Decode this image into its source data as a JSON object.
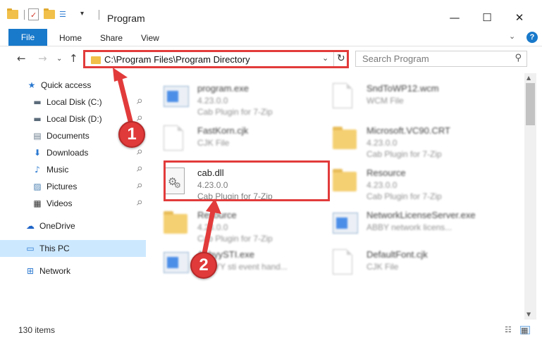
{
  "window": {
    "title": "Program",
    "controls": {
      "minimize": "—",
      "maximize": "☐",
      "close": "✕"
    }
  },
  "ribbon": {
    "tabs": [
      "File",
      "Home",
      "Share",
      "View"
    ],
    "expand": "⌄",
    "help": "?"
  },
  "nav": {
    "back": "←",
    "forward": "→",
    "recent": "⌄",
    "up": "↑",
    "address": "C:\\Program Files\\Program Directory",
    "address_dropdown": "⌄",
    "refresh": "↻",
    "search_placeholder": "Search Program",
    "search_icon": "search-icon"
  },
  "sidebar": {
    "items": [
      {
        "label": "Quick access",
        "icon": "star-icon",
        "glyph": "★",
        "color": "#2b79d0",
        "pinned": false
      },
      {
        "label": "Local Disk (C:)",
        "icon": "drive-icon",
        "glyph": "▬",
        "color": "#5b6b7a",
        "pinned": true
      },
      {
        "label": "Local Disk (D:)",
        "icon": "drive-icon",
        "glyph": "▬",
        "color": "#5b6b7a",
        "pinned": true
      },
      {
        "label": "Documents",
        "icon": "documents-icon",
        "glyph": "▤",
        "color": "#6a7c8c",
        "pinned": true
      },
      {
        "label": "Downloads",
        "icon": "download-icon",
        "glyph": "⬇",
        "color": "#2b79d0",
        "pinned": true
      },
      {
        "label": "Music",
        "icon": "music-icon",
        "glyph": "♪",
        "color": "#2b79d0",
        "pinned": true
      },
      {
        "label": "Pictures",
        "icon": "pictures-icon",
        "glyph": "▨",
        "color": "#4a7fb0",
        "pinned": true
      },
      {
        "label": "Videos",
        "icon": "videos-icon",
        "glyph": "▦",
        "color": "#333333",
        "pinned": true
      },
      {
        "label": "OneDrive",
        "icon": "cloud-icon",
        "glyph": "☁",
        "color": "#1e64c8",
        "pinned": false
      },
      {
        "label": "This PC",
        "icon": "computer-icon",
        "glyph": "▭",
        "color": "#2b79d0",
        "pinned": false,
        "selected": true
      },
      {
        "label": "Network",
        "icon": "network-icon",
        "glyph": "⊞",
        "color": "#2b79d0",
        "pinned": false
      }
    ],
    "pin_glyph": "📌"
  },
  "files": [
    {
      "name": "program.exe",
      "line1": "4.23.0.0",
      "line2": "Cab Plugin for 7-Zip",
      "kind": "exe",
      "blurred": true
    },
    {
      "name": "SndToWP12.wcm",
      "line1": "WCM File",
      "line2": "",
      "kind": "doc",
      "blurred": true
    },
    {
      "name": "FastKorn.cjk",
      "line1": "CJK File",
      "line2": "",
      "kind": "doc",
      "blurred": true
    },
    {
      "name": "Microsoft.VC90.CRT",
      "line1": "4.23.0.0",
      "line2": "Cab Plugin for 7-Zip",
      "kind": "folder",
      "blurred": true
    },
    {
      "name": "cab.dll",
      "line1": "4.23.0.0",
      "line2": "Cab Plugin for 7-Zip",
      "kind": "dll",
      "blurred": false
    },
    {
      "name": "Resource",
      "line1": "4.23.0.0",
      "line2": "Cab Plugin for 7-Zip",
      "kind": "folder",
      "blurred": true
    },
    {
      "name": "Resource",
      "line1": "4.23.0.0",
      "line2": "Cab Plugin for 7-Zip",
      "kind": "folder",
      "blurred": true
    },
    {
      "name": "NetworkLicenseServer.exe",
      "line1": "ABBY network licens...",
      "line2": "",
      "kind": "exe",
      "blurred": true
    },
    {
      "name": "AbbyySTI.exe",
      "line1": "ABBYY sti event hand...",
      "line2": "",
      "kind": "exe",
      "blurred": true
    },
    {
      "name": "DefaultFont.cjk",
      "line1": "CJK File",
      "line2": "",
      "kind": "doc",
      "blurred": true
    }
  ],
  "status": {
    "item_count": "130 items"
  },
  "annotations": {
    "step1": "1",
    "step2": "2",
    "accent": "#e23b3b"
  }
}
